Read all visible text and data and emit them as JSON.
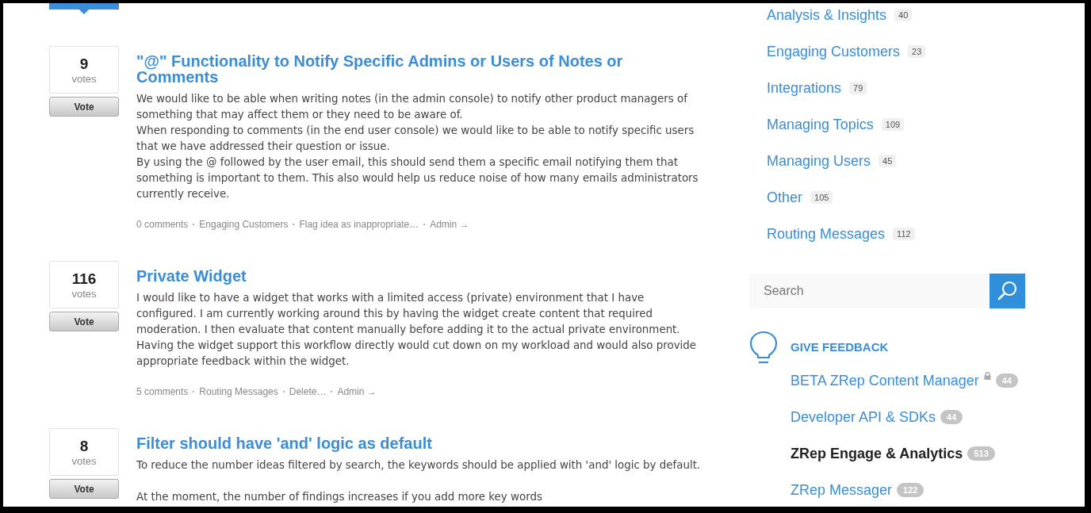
{
  "ideas": [
    {
      "votes": "9",
      "votes_label": "votes",
      "vote_button": "Vote",
      "title": "\"@\" Functionality to Notify Specific Admins or Users of Notes or Comments",
      "paragraphs": [
        "We would like to be able when writing notes (in the admin console) to notify other product managers of something that may affect them or they need to be aware of.",
        "When responding to comments (in the end user console) we would like to be able to notify specific users that we have addressed their question or issue.",
        "By using the @ followed by the user email, this should send them a specific email notifying them that something is important to them. This also would help us reduce noise of how many emails administrators currently receive."
      ],
      "meta": [
        "0 comments",
        "Engaging Customers",
        "Flag idea as inappropriate…",
        "Admin →"
      ]
    },
    {
      "votes": "116",
      "votes_label": "votes",
      "vote_button": "Vote",
      "title": "Private Widget",
      "paragraphs": [
        "I would like to have a widget that works with a limited access (private) environment that I have configured. I am currently working around this by having the widget create content that required moderation. I then evaluate that content manually before adding it to the actual private environment. Having the widget support this workflow directly would cut down on my workload and would also provide appropriate feedback within the widget."
      ],
      "meta": [
        "5 comments",
        "Routing Messages",
        "Delete…",
        "Admin →"
      ]
    },
    {
      "votes": "8",
      "votes_label": "votes",
      "vote_button": "Vote",
      "title": "Filter should have 'and' logic as default",
      "paragraphs": [
        "To reduce the number ideas filtered by search, the keywords should be applied with 'and' logic by default.",
        "At the moment, the number of findings increases if you add more key words"
      ]
    }
  ],
  "categories": [
    {
      "label": "Analysis & Insights",
      "count": "40"
    },
    {
      "label": "Engaging Customers",
      "count": "23"
    },
    {
      "label": "Integrations",
      "count": "79"
    },
    {
      "label": "Managing Topics",
      "count": "109"
    },
    {
      "label": "Managing Users",
      "count": "45"
    },
    {
      "label": "Other",
      "count": "105"
    },
    {
      "label": "Routing Messages",
      "count": "112"
    }
  ],
  "search": {
    "placeholder": "Search"
  },
  "feedback": {
    "heading": "GIVE FEEDBACK",
    "forums": [
      {
        "label": "BETA ZRep Content Manager",
        "count": "44",
        "locked": true,
        "selected": false
      },
      {
        "label": "Developer API & SDKs",
        "count": "44",
        "locked": false,
        "selected": false
      },
      {
        "label": "ZRep Engage & Analytics",
        "count": "513",
        "locked": false,
        "selected": true
      },
      {
        "label": "ZRep Messager",
        "count": "122",
        "locked": false,
        "selected": false
      }
    ]
  }
}
